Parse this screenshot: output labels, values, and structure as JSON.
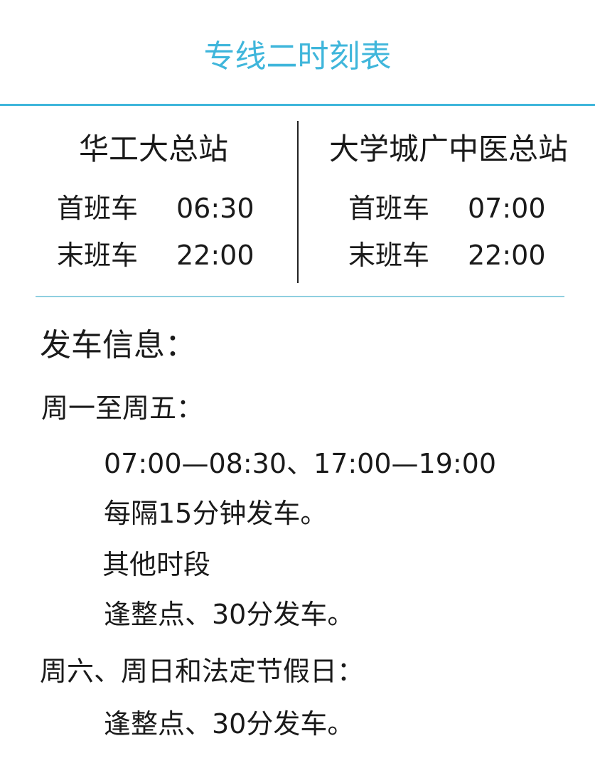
{
  "title": "专线二时刻表",
  "stations": [
    {
      "name": "华工大总站",
      "first_label": "首班车",
      "first_time": "06:30",
      "last_label": "末班车",
      "last_time": "22:00"
    },
    {
      "name": "大学城广中医总站",
      "first_label": "首班车",
      "first_time": "07:00",
      "last_label": "末班车",
      "last_time": "22:00"
    }
  ],
  "info": {
    "heading": "发车信息：",
    "weekday_label": "周一至周五：",
    "peak_hours": "07:00—08:30、17:00—19:00",
    "peak_interval": "每隔15分钟发车。",
    "other_label": "其他时段",
    "other_interval": "逢整点、30分发车。",
    "weekend_label": "周六、周日和法定节假日：",
    "weekend_interval": "逢整点、30分发车。"
  },
  "colors": {
    "accent": "#3fb6db",
    "divider": "#8fcfe0",
    "text": "#1a1a1a"
  }
}
